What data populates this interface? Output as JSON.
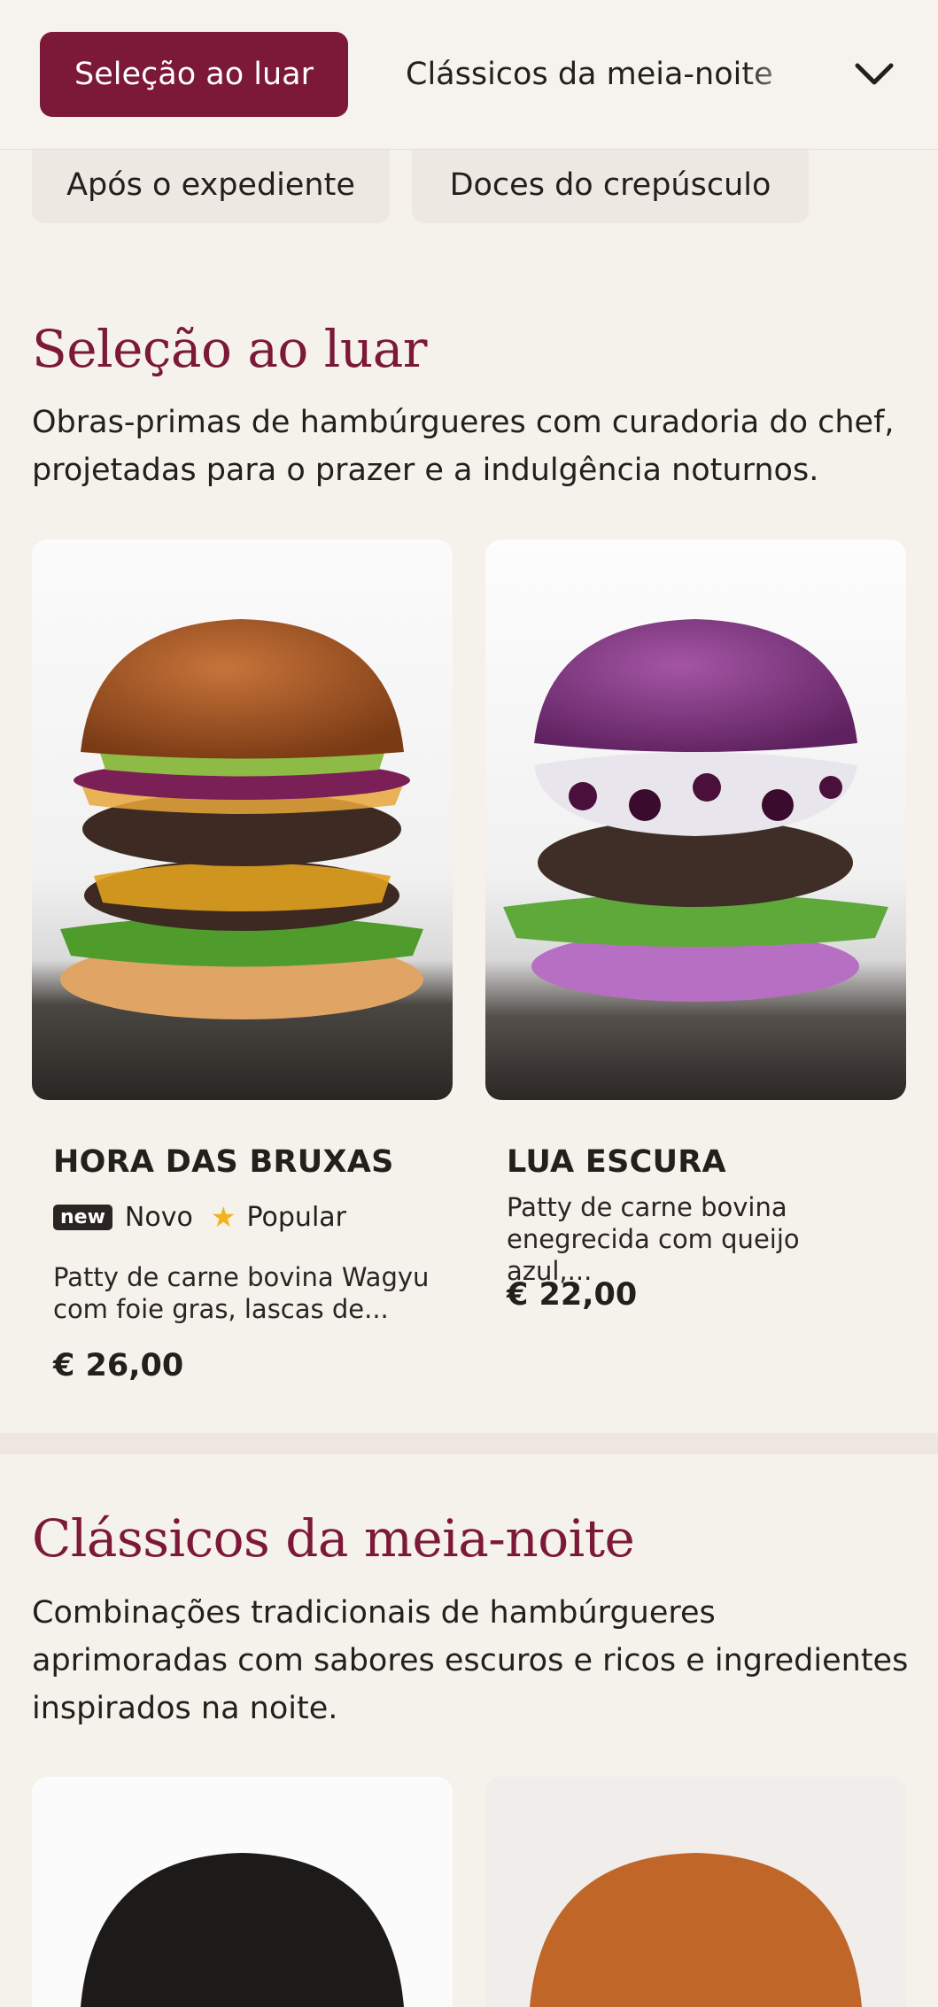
{
  "tabs": {
    "active": "Seleção ao luar",
    "next": "Clássicos da meia-noite",
    "row2": [
      "Após o expediente",
      "Doces do crepúsculo"
    ]
  },
  "sections": [
    {
      "title": "Seleção ao luar",
      "description": "Obras-primas de hambúrgueres com curadoria do chef, projetadas para o prazer e a indulgência noturnos.",
      "items": [
        {
          "name": "HORA DAS BRUXAS",
          "badge_new": "new",
          "badge_new_label": "Novo",
          "badge_popular_label": "Popular",
          "description": "Patty de carne bovina Wagyu com foie gras, lascas de...",
          "price": "€ 26,00"
        },
        {
          "name": "LUA ESCURA",
          "description": "Patty de carne bovina enegrecida com queijo azul,...",
          "price": "€ 22,00"
        }
      ]
    },
    {
      "title": "Clássicos da meia-noite",
      "description": "Combinações tradicionais de hambúrgueres aprimoradas com sabores escuros e ricos e ingredientes inspirados na noite."
    }
  ],
  "colors": {
    "accent": "#7c1838",
    "background": "#f5f1eb",
    "star": "#f2b41c"
  },
  "icons": [
    "chevron-down-icon",
    "star-icon",
    "new-badge"
  ]
}
